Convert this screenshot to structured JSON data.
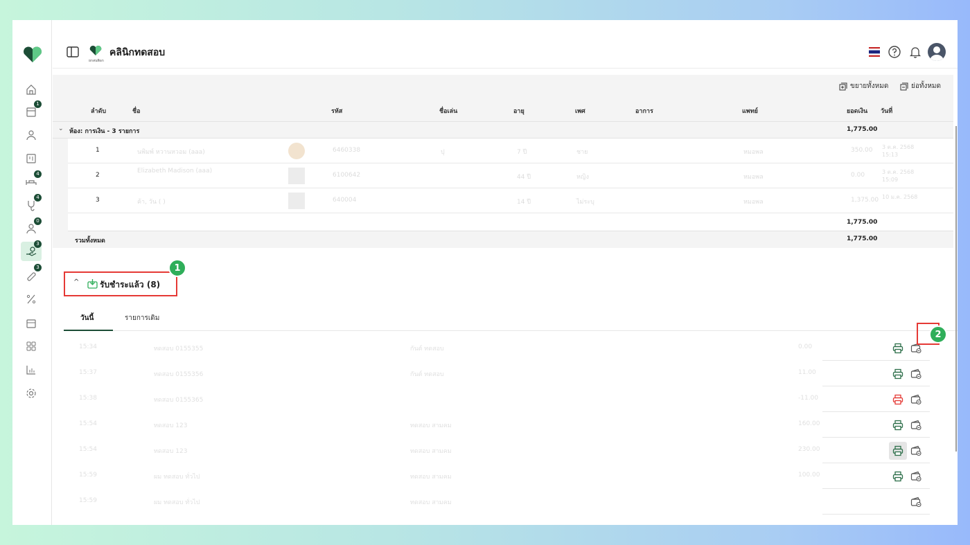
{
  "header": {
    "title": "คลินิกทดสอบ",
    "brand_caption": "ยกสนพิอก"
  },
  "sidebar": {
    "items": [
      {
        "name": "home",
        "icon": "home-icon",
        "badge": ""
      },
      {
        "name": "calendar",
        "icon": "calendar-icon",
        "badge": "1"
      },
      {
        "name": "patients",
        "icon": "user-icon",
        "badge": ""
      },
      {
        "name": "board",
        "icon": "board-icon",
        "badge": ""
      },
      {
        "name": "treatment",
        "icon": "bed-icon",
        "badge": "4"
      },
      {
        "name": "medicine",
        "icon": "stethoscope-icon",
        "badge": "4"
      },
      {
        "name": "doctor",
        "icon": "doctor-icon",
        "badge": "0"
      },
      {
        "name": "payment",
        "icon": "hand-money-icon",
        "badge": "3"
      },
      {
        "name": "pharmacy",
        "icon": "pill-icon",
        "badge": "3"
      },
      {
        "name": "discount",
        "icon": "percent-icon",
        "badge": ""
      },
      {
        "name": "store",
        "icon": "box-icon",
        "badge": ""
      },
      {
        "name": "apps",
        "icon": "grid-icon",
        "badge": ""
      },
      {
        "name": "reports",
        "icon": "chart-icon",
        "badge": ""
      },
      {
        "name": "settings",
        "icon": "gear-icon",
        "badge": ""
      }
    ]
  },
  "toolbar": {
    "expand_all": "ขยายทั้งหมด",
    "collapse_all": "ย่อทั้งหมด"
  },
  "columns": {
    "order": "ลำดับ",
    "name": "ชื่อ",
    "code": "รหัส",
    "nickname": "ชื่อเล่น",
    "age": "อายุ",
    "gender": "เพศ",
    "symptom": "อาการ",
    "doctor": "แพทย์",
    "amount": "ยอดเงิน",
    "date": "วันที่"
  },
  "group": {
    "label": "ห้อง: การเงิน - 3 รายการ",
    "amount": "1,775.00"
  },
  "rows": [
    {
      "num": "1",
      "name": "นพิมพ์ หวานหวอม (aaa)",
      "code": "6460338",
      "nickname": "ปุ",
      "age": "7 ปี",
      "gender": "ชาย",
      "doctor": "หมอพล",
      "amount": "350.00",
      "date": "3 ต.ค. 2568 15:13"
    },
    {
      "num": "2",
      "name": "Elizabeth Madison (aaa)",
      "code": "6100642",
      "nickname": "",
      "age": "44 ปี",
      "gender": "หญิง",
      "doctor": "หมอพล",
      "amount": "0.00",
      "date": "3 ต.ค. 2568 15:09"
    },
    {
      "num": "3",
      "name": "ค้า, วัน ( )",
      "code": "640004",
      "nickname": "",
      "age": "14 ปี",
      "gender": "ไม่ระบุ",
      "doctor": "หมอพล",
      "amount": "1,375.00",
      "date": "10 ม.ค. 2568"
    }
  ],
  "subtotal": "1,775.00",
  "total": {
    "label": "รวมทั้งหมด",
    "amount": "1,775.00"
  },
  "paid": {
    "title": "รับชำระแล้ว (8)",
    "marker1": "1",
    "marker2": "2"
  },
  "tabs": [
    {
      "label": "วันนี้",
      "active": true
    },
    {
      "label": "รายการเดิม",
      "active": false
    }
  ],
  "payments": [
    {
      "time": "15:34",
      "ref": "ทดสอบ 0155355",
      "payer": "กันต์ ทดสอบ",
      "amount": "0.00",
      "printer_color": "green"
    },
    {
      "time": "15:37",
      "ref": "ทดสอบ 0155356",
      "payer": "กันต์ ทดสอบ",
      "amount": "11.00",
      "printer_color": "green"
    },
    {
      "time": "15:38",
      "ref": "ทดสอบ 0155365",
      "payer": "",
      "amount": "-11.00",
      "printer_color": "red"
    },
    {
      "time": "15:54",
      "ref": "ทดสอบ 123",
      "payer": "ทดสอบ สามคม",
      "amount": "160.00",
      "printer_color": "green"
    },
    {
      "time": "15:54",
      "ref": "ทดสอบ 123",
      "payer": "ทดสอบ สามคม",
      "amount": "230.00",
      "printer_color": "green"
    },
    {
      "time": "15:59",
      "ref": "ผม ทดสอบ ทั่วไป",
      "payer": "ทดสอบ สามคม",
      "amount": "100.00",
      "printer_color": "green"
    },
    {
      "time": "15:59",
      "ref": "ผม ทดสอบ ทั่วไป",
      "payer": "ทดสอบ สามคม",
      "amount": "",
      "printer_color": "none"
    }
  ],
  "colors": {
    "brand_green": "#1c4d36",
    "accent_green": "#2fae5a",
    "highlight_red": "#e53935",
    "print_red": "#e53935",
    "print_green": "#2c6e49"
  }
}
